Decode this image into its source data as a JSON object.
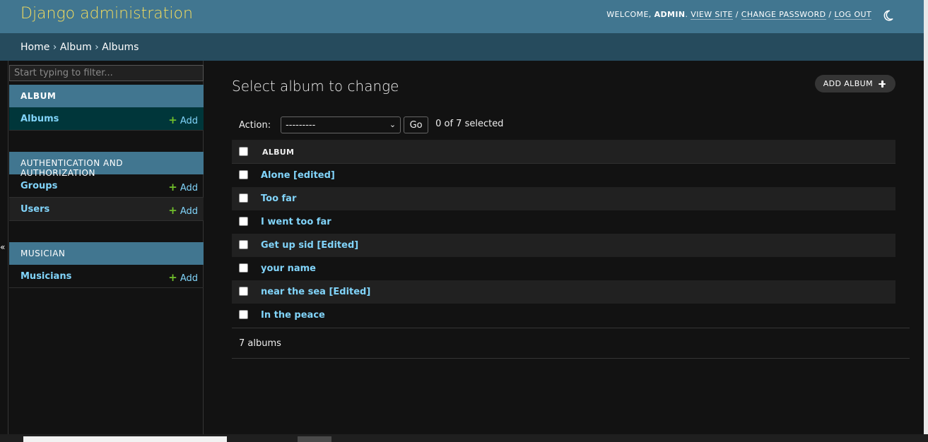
{
  "header": {
    "site_name": "Django administration",
    "welcome_prefix": "WELCOME, ",
    "username": "ADMIN",
    "view_site": "VIEW SITE",
    "change_password": "CHANGE PASSWORD",
    "log_out": "LOG OUT",
    "separator": " / ",
    "theme_icon": "moon-icon"
  },
  "breadcrumbs": {
    "home": "Home",
    "app": "Album",
    "current": "Albums",
    "sep": " › "
  },
  "sidebar": {
    "filter_placeholder": "Start typing to filter...",
    "add_label": "Add",
    "collapse_icon": "«",
    "modules": [
      {
        "caption": "ALBUM",
        "models": [
          {
            "name": "Albums",
            "selected": true
          }
        ]
      },
      {
        "caption": "AUTHENTICATION AND AUTHORIZATION",
        "models": [
          {
            "name": "Groups"
          },
          {
            "name": "Users"
          }
        ]
      },
      {
        "caption": "MUSICIAN",
        "models": [
          {
            "name": "Musicians"
          }
        ]
      }
    ]
  },
  "content": {
    "title": "Select album to change",
    "add_button": "ADD ALBUM",
    "action_label": "Action:",
    "action_value": "---------",
    "go_label": "Go",
    "selected_count": "0 of 7 selected",
    "column_header": "ALBUM",
    "rows": [
      "Alone [edited]",
      "Too far",
      "I went too far",
      "Get up sid [Edited]",
      "your name",
      "near the sea [Edited]",
      "In the peace"
    ],
    "paginator": "7 albums"
  },
  "colors": {
    "header_bg": "#417690",
    "branding": "#f5dd5d",
    "breadcrumbs_bg": "#264b5d",
    "link": "#81d4fa",
    "add_plus": "#70bf2b",
    "body_bg": "#121212"
  }
}
